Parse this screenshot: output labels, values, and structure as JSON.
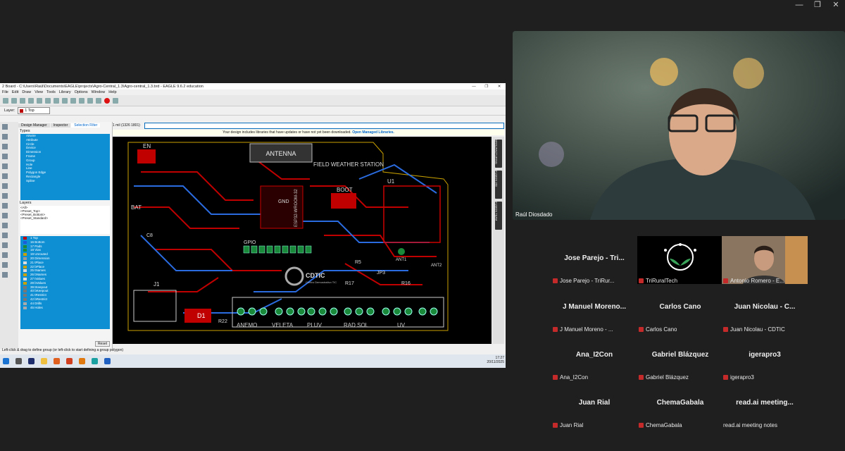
{
  "window_controls": [
    "—",
    "❐",
    "✕"
  ],
  "eagle": {
    "title": "2 Board - C:\\Users\\Raúl\\Documents\\EAGLE\\projects\\Agro-Central_1.3\\Agro-central_1.3.brd - EAGLE 9.6.2 education",
    "menu": [
      "File",
      "Edit",
      "Draw",
      "View",
      "Tools",
      "Library",
      "Options",
      "Window",
      "Help"
    ],
    "layer_label": "Layer:",
    "layer_value": "1 Top",
    "tabs": [
      "Design Manager",
      "Inspector",
      "Selection Filter"
    ],
    "types_label": "Types",
    "types": [
      "Airwire",
      "Attribute",
      "Circle",
      "Device",
      "Dimension",
      "Frame",
      "Group",
      "Hole",
      "Line",
      "Polygon Edge",
      "Rectangle",
      "Spline"
    ],
    "layers_label": "Layers",
    "presets": [
      "<All>",
      "<Preset_Top>",
      "<Preset_Bottom>",
      "<Preset_Standard>"
    ],
    "layer_items": [
      {
        "name": "1 Top",
        "color": "#c00000"
      },
      {
        "name": "16 Bottom",
        "color": "#1e5bd8"
      },
      {
        "name": "17 Pads",
        "color": "#1a8a3a"
      },
      {
        "name": "18 Vias",
        "color": "#1a8a3a"
      },
      {
        "name": "19 Unrouted",
        "color": "#c8a000"
      },
      {
        "name": "20 Dimension",
        "color": "#999999"
      },
      {
        "name": "21 tPlace",
        "color": "#dddddd"
      },
      {
        "name": "22 bPlace",
        "color": "#c8a000"
      },
      {
        "name": "25 tNames",
        "color": "#dddddd"
      },
      {
        "name": "26 bNames",
        "color": "#c8a000"
      },
      {
        "name": "27 tValues",
        "color": "#dddddd"
      },
      {
        "name": "28 bValues",
        "color": "#c8a000"
      },
      {
        "name": "39 tKeepout",
        "color": "#777777"
      },
      {
        "name": "40 bKeepout",
        "color": "#777777"
      },
      {
        "name": "41 tRestrict",
        "color": "#777777"
      },
      {
        "name": "42 bRestrict",
        "color": "#777777"
      },
      {
        "name": "44 Drills",
        "color": "#aaaaaa"
      },
      {
        "name": "45 Holes",
        "color": "#aaaaaa"
      }
    ],
    "reset": "Reset",
    "coord": "1 mil (1326 1801)",
    "notice": "Your design includes libraries that have updates or have not yet been downloaded.",
    "notice_link": "Open Managed Libraries.",
    "side_tabs": [
      "MANUFACTURING",
      "FUSION 360",
      "FUSION TEAM"
    ],
    "status": "Left-click & drag to define group (or left-click to start defining a group polygon)",
    "clock_time": "17:27",
    "clock_date": "20/11/2025",
    "board_labels": {
      "antenna": "ANTENNA",
      "station": "FIELD WEATHER STATION",
      "boot": "BOOT",
      "gpio": "GPIO",
      "cdtic": "CDTIC",
      "cdtic_sub": "Centro Demostrativo TIC",
      "en": "EN",
      "u1": "U1",
      "bat": "BAT",
      "j1": "J1",
      "d1": "D1",
      "r22": "R22",
      "ant1": "ANT1",
      "ant2": "ANT2",
      "gnd": "GND",
      "esp": "ESP32-WROOM-32",
      "jp3": "JP3",
      "r16": "R16",
      "r17": "R17",
      "r5": "R5",
      "c8": "C8",
      "conn": [
        "ANEMO",
        "VELETA",
        "PLUV",
        "RAD SOL",
        "UV"
      ]
    }
  },
  "speaker": {
    "name": "Raúl Diosdado"
  },
  "participants": [
    {
      "big": "Jose Parejo - Tri...",
      "label": "Jose Parejo - TriRur..."
    },
    {
      "big": "",
      "label": "TriRuralTech",
      "logo": true
    },
    {
      "big": "",
      "label": "Antonio Romero - E...",
      "video": true
    },
    {
      "big": "J Manuel Moreno...",
      "label": "J Manuel Moreno - ..."
    },
    {
      "big": "Carlos Cano",
      "label": "Carlos Cano"
    },
    {
      "big": "Juan Nicolau - C...",
      "label": "Juan Nicolau - CDTIC"
    },
    {
      "big": "Ana_I2Con",
      "label": "Ana_I2Con"
    },
    {
      "big": "Gabriel Blázquez",
      "label": "Gabriel Blázquez"
    },
    {
      "big": "igerapro3",
      "label": "igerapro3"
    },
    {
      "big": "Juan Rial",
      "label": "Juan Rial"
    },
    {
      "big": "ChemaGabala",
      "label": "ChemaGabala"
    },
    {
      "big": "read.ai  meeting...",
      "label": "read.ai meeting notes",
      "nomic": true
    }
  ]
}
